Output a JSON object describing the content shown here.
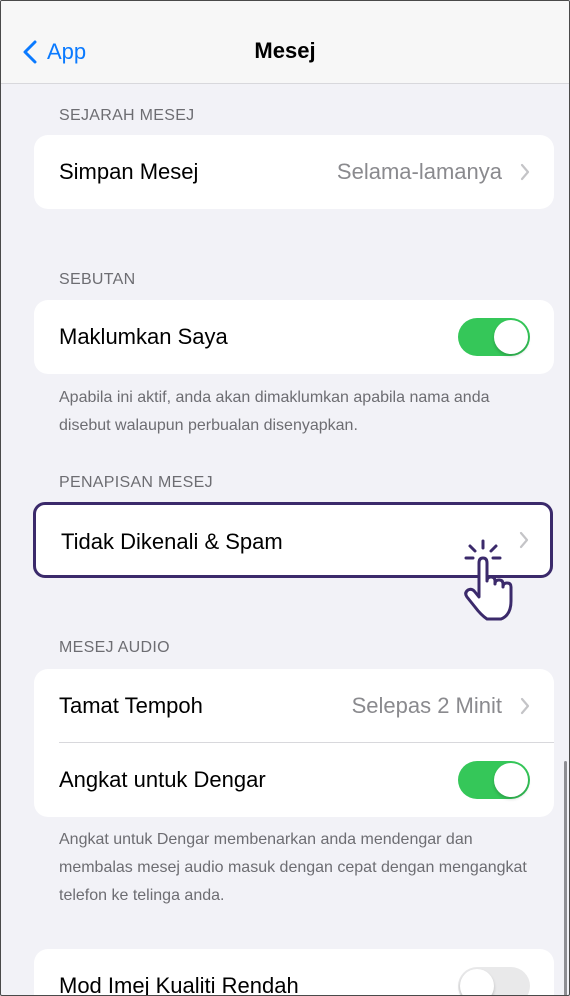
{
  "navbar": {
    "back_label": "App",
    "title": "Mesej"
  },
  "sections": {
    "history": {
      "header": "SEJARAH MESEJ",
      "keep_label": "Simpan Mesej",
      "keep_value": "Selama-lamanya"
    },
    "mentions": {
      "header": "SEBUTAN",
      "notify_label": "Maklumkan Saya",
      "notify_on": true,
      "footer": "Apabila ini aktif, anda akan dimaklumkan apabila nama anda disebut walaupun perbualan disenyapkan."
    },
    "filtering": {
      "header": "PENAPISAN MESEJ",
      "unknown_label": "Tidak Dikenali & Spam"
    },
    "audio": {
      "header": "MESEJ AUDIO",
      "expire_label": "Tamat Tempoh",
      "expire_value": "Selepas 2 Minit",
      "raise_label": "Angkat untuk Dengar",
      "raise_on": true,
      "footer": "Angkat untuk Dengar membenarkan anda mendengar dan membalas mesej audio masuk dengan cepat dengan mengangkat telefon ke telinga anda."
    },
    "image": {
      "lowquality_label": "Mod Imej Kualiti Rendah",
      "lowquality_on": false
    }
  },
  "colors": {
    "accent": "#0a7aff",
    "toggle_on": "#35c759",
    "highlight": "#3b2a6b"
  },
  "icons": {
    "back": "chevron-left-icon",
    "disclosure": "chevron-right-icon",
    "pointer": "hand-pointer-icon"
  }
}
